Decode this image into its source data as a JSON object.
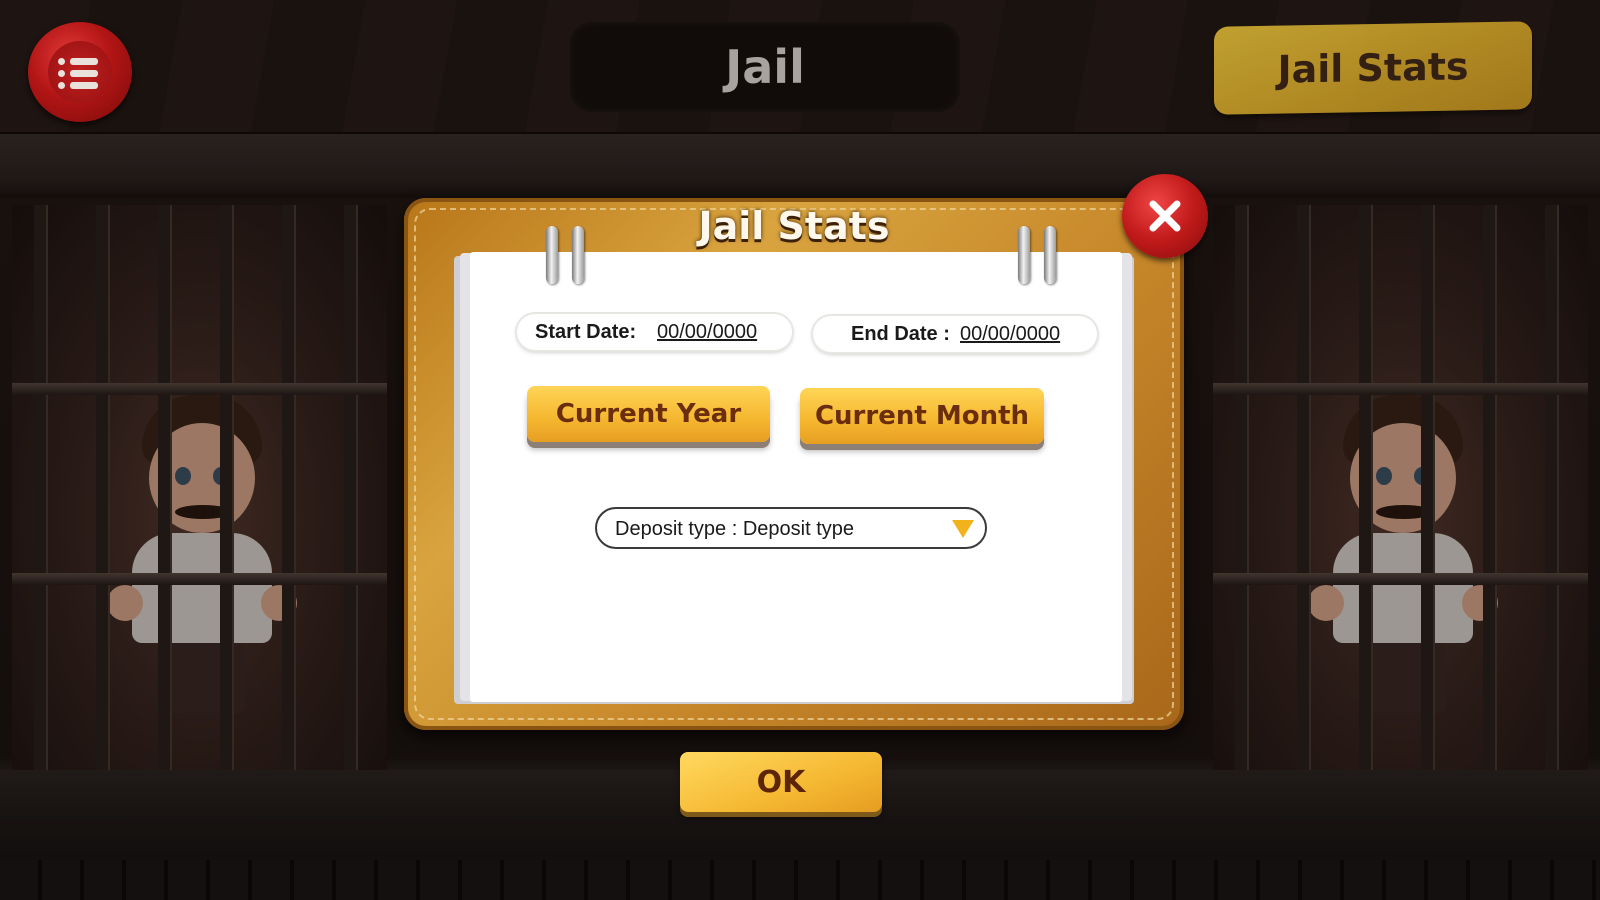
{
  "header": {
    "title": "Jail",
    "stats_tab_label": "Jail Stats",
    "menu_icon": "list-icon"
  },
  "dialog": {
    "title": "Jail Stats",
    "close_icon": "close-icon",
    "start_date": {
      "label": "Start Date:",
      "value": "00/00/0000"
    },
    "end_date": {
      "label": "End Date :",
      "value": "00/00/0000"
    },
    "current_year_label": "Current Year",
    "current_month_label": "Current Month",
    "deposit_type": {
      "text": "Deposit type : Deposit type",
      "icon": "dropdown-triangle-icon"
    }
  },
  "footer": {
    "ok_label": "OK"
  },
  "colors": {
    "gold": "#f5b62f",
    "button_text": "#6a2e0e",
    "wax_red": "#c11a1a",
    "frame_brown": "#c6872a"
  }
}
